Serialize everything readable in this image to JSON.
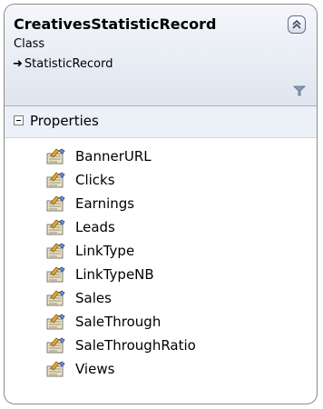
{
  "class_shape": {
    "name": "CreativesStatisticRecord",
    "stereotype": "Class",
    "base_type": "StatisticRecord",
    "base_arrow_icon": "inheritance-arrow-icon",
    "collapse_icon": "double-chevron-up-icon",
    "filter_icon": "filter-funnel-icon"
  },
  "section": {
    "title": "Properties",
    "toggle_icon": "minus-box-icon",
    "item_icon": "property-icon",
    "items": [
      "BannerURL",
      "Clicks",
      "Earnings",
      "Leads",
      "LinkType",
      "LinkTypeNB",
      "Sales",
      "SaleThrough",
      "SaleThroughRatio",
      "Views"
    ]
  },
  "colors": {
    "header_gradient_top": "#f4f6fa",
    "header_gradient_bottom": "#dfe5ef",
    "border": "#8a8a8a"
  }
}
